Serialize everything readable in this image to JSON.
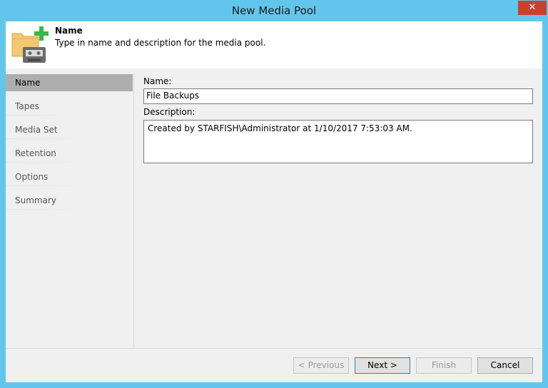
{
  "window": {
    "title": "New Media Pool",
    "close_label": "✕"
  },
  "header": {
    "title": "Name",
    "description": "Type in name and description for the media pool."
  },
  "nav": {
    "items": [
      {
        "label": "Name"
      },
      {
        "label": "Tapes"
      },
      {
        "label": "Media Set"
      },
      {
        "label": "Retention"
      },
      {
        "label": "Options"
      },
      {
        "label": "Summary"
      }
    ]
  },
  "form": {
    "name_label": "Name:",
    "name_value": "File Backups",
    "description_label": "Description:",
    "description_value": "Created by STARFISH\\Administrator at 1/10/2017 7:53:03 AM."
  },
  "buttons": {
    "previous": "< Previous",
    "next": "Next >",
    "finish": "Finish",
    "cancel": "Cancel"
  },
  "colors": {
    "window_border": "#62c6ec",
    "close_button": "#c8412c",
    "nav_selected": "#aeaeae",
    "add_icon": "#3cb54a"
  }
}
